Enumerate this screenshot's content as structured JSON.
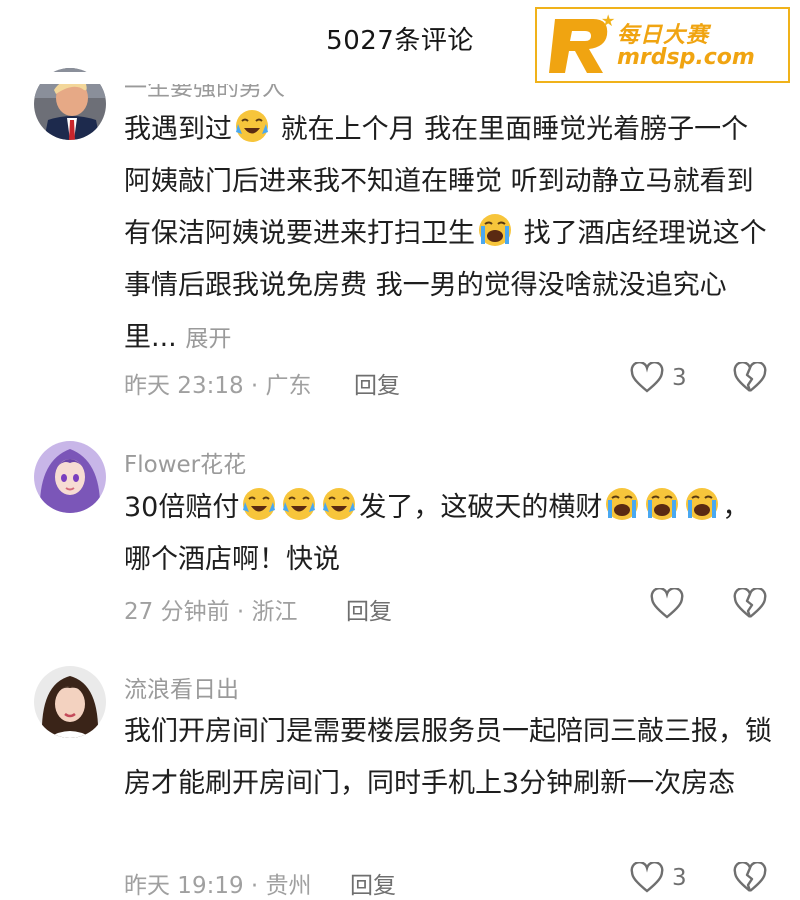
{
  "header": {
    "title": "5027条评论"
  },
  "watermark": {
    "text_cn": "每日大赛",
    "url": "mrdsp.com"
  },
  "comments": [
    {
      "username": "一生要强的男人",
      "segments": [
        "我遇到过",
        "😭",
        " 就在上个月 我在里面睡觉光着膀子一个阿姨敲门后进来我不知道在睡觉  听到动静立马就看到有保洁阿姨说要进来打扫卫生",
        "😭",
        " 找了酒店经理说这个事情后跟我说免房费 我一男的觉得没啥就没追究心里... "
      ],
      "expand_label": "展开",
      "time_location": "昨天 23:18 · 广东",
      "reply_label": "回复",
      "like_count": "3"
    },
    {
      "username": "Flower花花",
      "segments": [
        "30倍赔付",
        "😭😭😭",
        "发了，这破天的横财",
        "😭😭😭",
        "，哪个酒店啊！快说"
      ],
      "time_location": "27 分钟前 · 浙江",
      "reply_label": "回复",
      "like_count": ""
    },
    {
      "username": "流浪看日出",
      "segments": [
        "我们开房间门是需要楼层服务员一起陪同三敲三报，锁房才能刷开房间门，同时手机上3分钟刷新一次房态"
      ],
      "time_location": "昨天 19:19 · 贵州",
      "reply_label": "回复",
      "like_count": "3"
    }
  ],
  "colors": {
    "accent": "#f0b21a",
    "meta": "#a0a0a0",
    "text": "#1e1e1e"
  }
}
